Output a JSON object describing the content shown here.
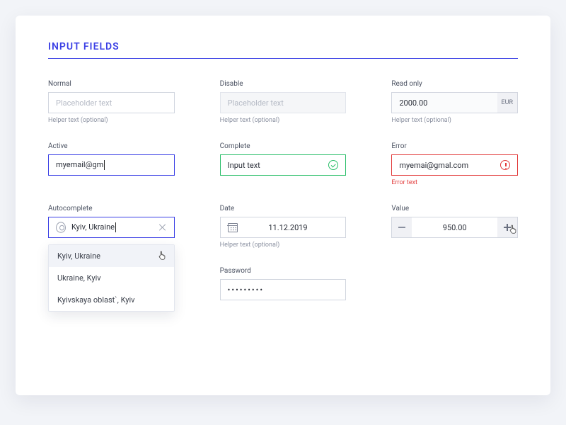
{
  "heading": "INPUT FIELDS",
  "normal": {
    "label": "Normal",
    "placeholder": "Placeholder text",
    "helper": "Helper text (optional)"
  },
  "disable": {
    "label": "Disable",
    "placeholder": "Placeholder text",
    "helper": "Helper text (optional)"
  },
  "readonly": {
    "label": "Read only",
    "value": "2000.00",
    "unit": "EUR",
    "helper": "Helper text (optional)"
  },
  "active": {
    "label": "Active",
    "value": "myemail@gm"
  },
  "complete": {
    "label": "Complete",
    "value": "Input text"
  },
  "error": {
    "label": "Error",
    "value": "myemai@gmal.com",
    "helper": "Error text"
  },
  "auto": {
    "label": "Autocomplete",
    "value": "Kyiv, Ukraine",
    "options": [
      "Kyiv, Ukraine",
      "Ukraine, Kyiv",
      "Kyivskaya oblast`, Kyiv"
    ]
  },
  "date": {
    "label": "Date",
    "value": "11.12.2019",
    "helper": "Helper text (optional)"
  },
  "value": {
    "label": "Value",
    "value": "950.00"
  },
  "password": {
    "label": "Password",
    "mask": "•••••••••"
  }
}
